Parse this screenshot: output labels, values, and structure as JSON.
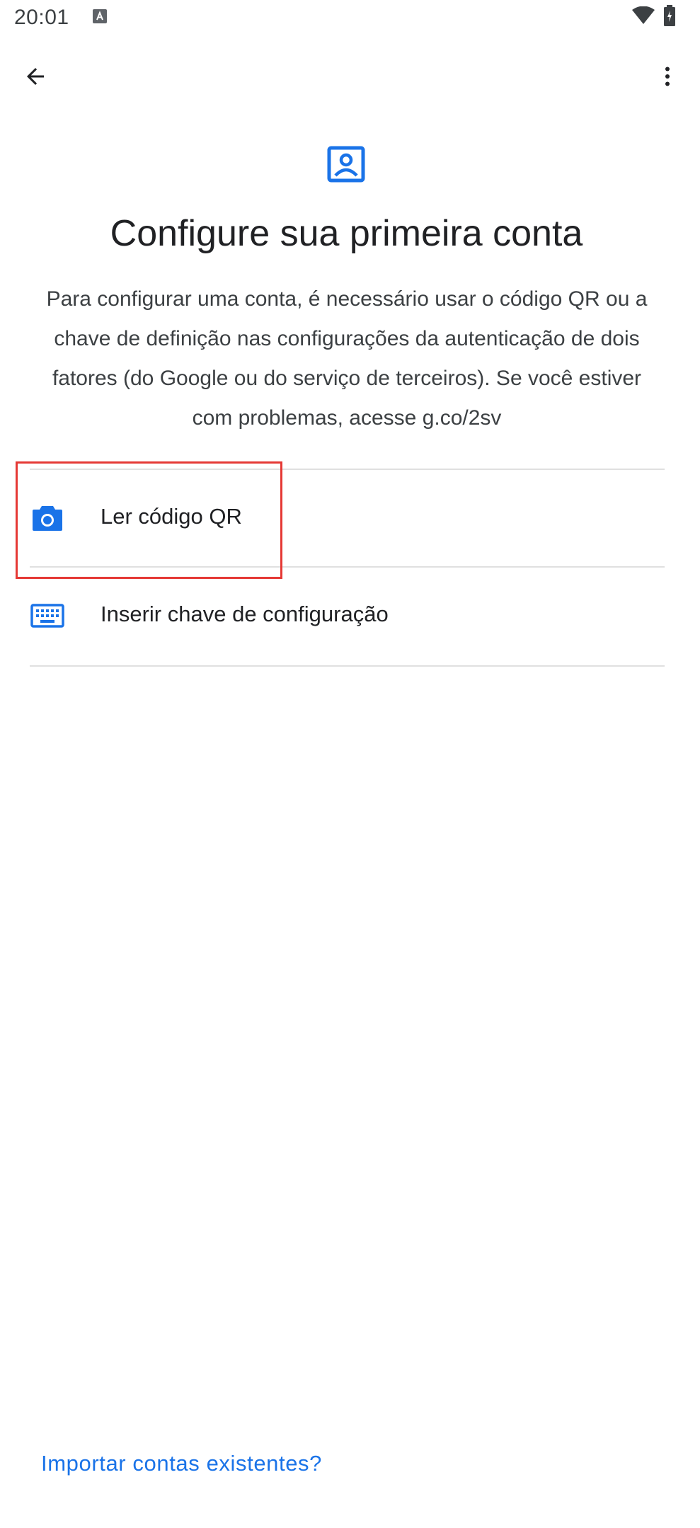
{
  "status_bar": {
    "time": "20:01",
    "notification_icon": "a-box-icon",
    "wifi_icon": "wifi-icon",
    "battery_icon": "battery-icon"
  },
  "toolbar": {
    "back_icon": "arrow-back-icon",
    "more_icon": "more-vert-icon"
  },
  "header": {
    "icon": "account-box-icon",
    "title": "Configure sua primeira conta",
    "description": "Para configurar uma conta, é necessário usar o código QR ou a chave de definição nas configurações da autenticação de dois fatores (do Google ou do serviço de terceiros). Se você estiver com problemas, acesse g.co/2sv"
  },
  "options": [
    {
      "icon": "camera-icon",
      "label": "Ler código QR"
    },
    {
      "icon": "keyboard-icon",
      "label": "Inserir chave de configuração"
    }
  ],
  "footer": {
    "import_link": "Importar contas existentes?"
  },
  "colors": {
    "accent": "#1a73e8",
    "highlight": "#e53935",
    "text": "#202124",
    "divider": "#e0e0e0"
  }
}
